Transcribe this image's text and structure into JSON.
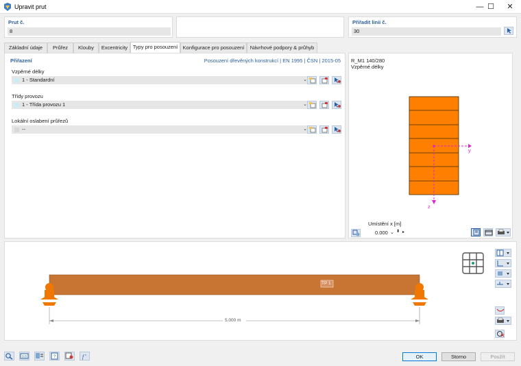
{
  "window": {
    "title": "Upravit prut",
    "minimize": "—",
    "maximize": "☐",
    "close": "✕"
  },
  "header": {
    "member_label": "Prut č.",
    "member_value": "8",
    "line_label": "Přiřadit linii č.",
    "line_value": "30"
  },
  "tabs": [
    {
      "label": "Základní údaje"
    },
    {
      "label": "Průřez"
    },
    {
      "label": "Klouby"
    },
    {
      "label": "Excentricity"
    },
    {
      "label": "Typy pro posouzení",
      "active": true
    },
    {
      "label": "Konfigurace pro posouzení"
    },
    {
      "label": "Návrhové podpory & průhyb"
    }
  ],
  "assignment": {
    "title": "Přiřazení",
    "standard": "Posouzení dřevěných konstrukcí | EN 1995 | ČSN | 2015-05",
    "fields": [
      {
        "label": "Vzpěrné délky",
        "value": "1 - Standardní"
      },
      {
        "label": "Třídy provozu",
        "value": "1 - Třída provozu 1"
      },
      {
        "label": "Lokální oslabení průřezů",
        "value": "--"
      }
    ]
  },
  "section_preview": {
    "name": "R_M1 140/280",
    "subtitle": "Vzpěrné délky",
    "axis_y": "y",
    "axis_z": "z",
    "position_label": "Umístění x [m]",
    "position_value": "0.000"
  },
  "model": {
    "member_tag": "TP 1",
    "dimension": "5.000 m"
  },
  "buttons": {
    "ok": "OK",
    "cancel": "Storno",
    "apply": "Použít"
  },
  "colors": {
    "accent": "#2b5f9e",
    "beam": "#c87533",
    "section": "#ff8000",
    "support": "#f07800"
  }
}
